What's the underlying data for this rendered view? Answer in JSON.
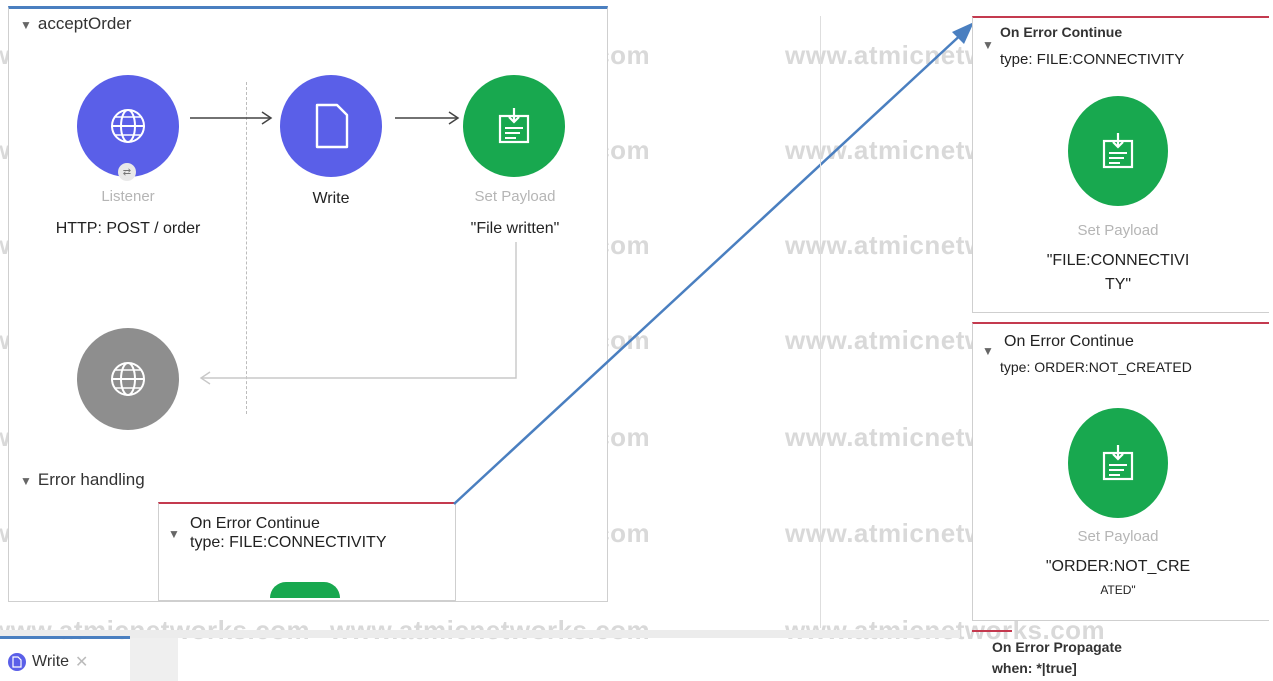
{
  "watermark": "www.atmicnetworks.com",
  "flow": {
    "name": "acceptOrder",
    "listener": {
      "type_label": "Listener",
      "name": "HTTP: POST / order"
    },
    "write": {
      "name": "Write"
    },
    "set_payload": {
      "type_label": "Set Payload",
      "value": "\"File written\""
    }
  },
  "error_handling": {
    "title": "Error handling",
    "on_error_continue": {
      "title": "On Error Continue",
      "type": "type: FILE:CONNECTIVITY"
    }
  },
  "right_panel": {
    "handler1": {
      "title": "On Error Continue",
      "type": "type: FILE:CONNECTIVITY",
      "type_label": "Set Payload",
      "value_line1": "\"FILE:CONNECTIVI",
      "value_line2": "TY\""
    },
    "handler2": {
      "title": "On Error Continue",
      "type": "type: ORDER:NOT_CREATED",
      "type_label": "Set Payload",
      "value_line1": "\"ORDER:NOT_CRE",
      "value_line2": "ATED\""
    },
    "handler3": {
      "title": "On Error Propagate",
      "when": "when: *|true]"
    }
  },
  "bottom_tab": {
    "label": "Write"
  },
  "colors": {
    "accent_blue": "#5a5fe8",
    "success_green": "#18a84f",
    "error_red": "#c43a4f",
    "arrow_blue": "#4a7fc0"
  }
}
